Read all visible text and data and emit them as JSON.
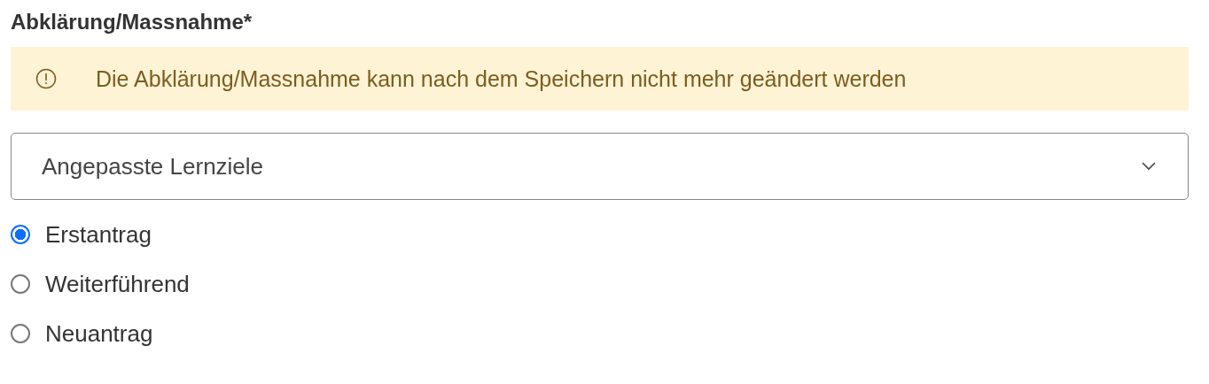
{
  "label": "Abklärung/Massnahme*",
  "alert": {
    "text": "Die Abklärung/Massnahme kann nach dem Speichern nicht mehr geändert werden"
  },
  "select": {
    "value": "Angepasste Lernziele"
  },
  "options": [
    {
      "label": "Erstantrag",
      "selected": true
    },
    {
      "label": "Weiterführend",
      "selected": false
    },
    {
      "label": "Neuantrag",
      "selected": false
    }
  ]
}
